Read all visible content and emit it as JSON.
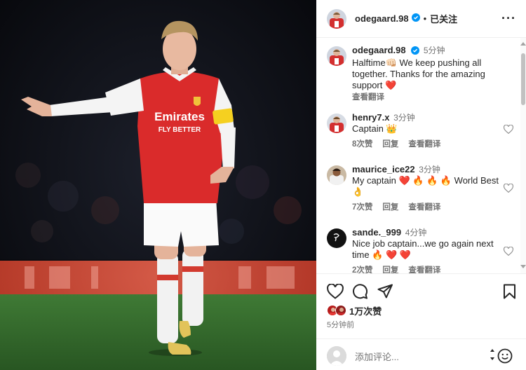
{
  "post": {
    "username": "odegaard.98",
    "follow_label": "已关注",
    "more_label": "···"
  },
  "caption": {
    "username": "odegaard.98",
    "time": "5分钟",
    "text": "Halftime👊🏻 We keep pushing all together. Thanks for the amazing support ❤️",
    "see_translation": "查看翻译"
  },
  "comments": [
    {
      "username": "henry7.x",
      "time": "3分钟",
      "text": "Captain 👑",
      "likes": "8次赞",
      "reply": "回复",
      "see_translation": "查看翻译"
    },
    {
      "username": "maurice_ice22",
      "time": "3分钟",
      "text": "My captain ❤️ 🔥 🔥 🔥 World Best 👌",
      "likes": "7次赞",
      "reply": "回复",
      "see_translation": "查看翻译"
    },
    {
      "username": "sande._999",
      "time": "4分钟",
      "text": "Nice job captain...we go again next time 🔥 ❤️ ❤️",
      "likes": "2次赞",
      "reply": "回复",
      "see_translation": "查看翻译"
    }
  ],
  "stats": {
    "likes": "1万次赞",
    "posted": "5分钟前"
  },
  "add_comment": {
    "placeholder": "添加评论..."
  },
  "photo": {
    "shirt_sponsor_1": "Emirates",
    "shirt_sponsor_2": "FLY BETTER"
  },
  "colors": {
    "verified": "#0095f6",
    "secondary_text": "#737373",
    "primary_text": "#262626",
    "heart": "#ed4956",
    "divider": "#efefef"
  },
  "icons": {
    "like": "heart-icon",
    "comment": "comment-icon",
    "share": "paper-plane-icon",
    "save": "bookmark-icon",
    "emoji": "smiley-icon",
    "more": "more-horizontal-icon",
    "verified": "verified-badge-icon"
  }
}
